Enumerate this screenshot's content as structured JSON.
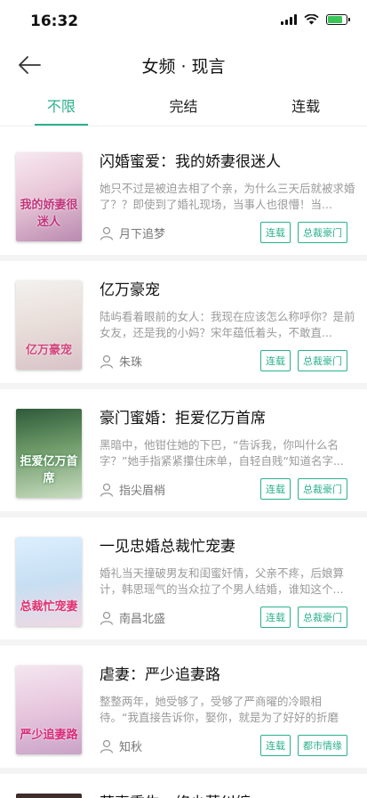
{
  "status": {
    "time": "16:32"
  },
  "nav": {
    "title": "女频 · 现言"
  },
  "tabs": [
    {
      "label": "不限"
    },
    {
      "label": "完结"
    },
    {
      "label": "连载"
    }
  ],
  "books": [
    {
      "title": "闪婚蜜爱：我的娇妻很迷人",
      "desc": "她只不过是被迫去相了个亲，为什么三天后就被求婚了？？即使到了婚礼现场，当事人也很懵！当...",
      "author": "月下追梦",
      "tags": [
        "连载",
        "总裁豪门"
      ],
      "cover_text": "我的娇妻很迷人"
    },
    {
      "title": "亿万豪宠",
      "desc": "陆屿看着眼前的女人：我现在应该怎么称呼你？是前女友，还是我的小妈？宋年蕴低着头，不敢直...",
      "author": "朱珠",
      "tags": [
        "连载",
        "总裁豪门"
      ],
      "cover_text": "亿万豪宠"
    },
    {
      "title": "豪门蜜婚：拒爱亿万首席",
      "desc": "黑暗中，他钳住她的下巴，“告诉我，你叫什么名字？”她手指紧紧攥住床单，自轻自贱“知道名字...",
      "author": "指尖眉梢",
      "tags": [
        "连载",
        "总裁豪门"
      ],
      "cover_text": "拒爱亿万首席"
    },
    {
      "title": "一见忠婚总裁忙宠妻",
      "desc": "婚礼当天撞破男友和闺蜜奸情，父亲不疼，后娘算计，韩思瑶气的当众拉了个男人结婚，谁知这个...",
      "author": "南昌北盛",
      "tags": [
        "连载",
        "总裁豪门"
      ],
      "cover_text": "总裁忙宠妻"
    },
    {
      "title": "虐妻：严少追妻路",
      "desc": "整整两年，她受够了，受够了严商曜的冷眼相待。“我直接告诉你，娶你，就是为了好好的折磨你...",
      "author": "知秋",
      "tags": [
        "连载",
        "都市情缘"
      ],
      "cover_text": "严少追妻路"
    }
  ],
  "partial_book": {
    "title": "萌妻重生：修少莫纠缠"
  },
  "colors": {
    "accent": "#2bb08c"
  }
}
